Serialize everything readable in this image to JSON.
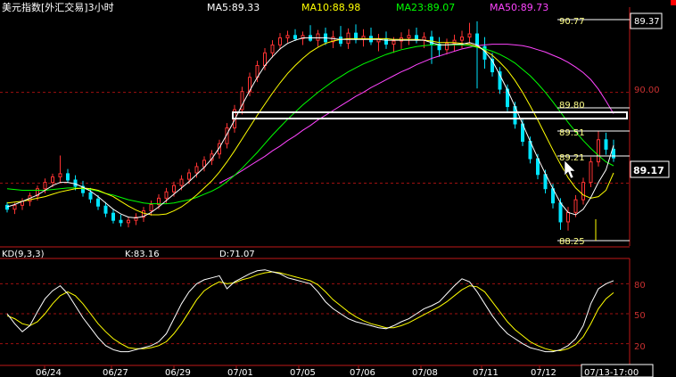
{
  "header": {
    "title": "美元指数[外汇交易]3小时",
    "ma_items": [
      {
        "label": "MA5:89.33",
        "color": "#ffffff"
      },
      {
        "label": "MA10:88.98",
        "color": "#ffff00"
      },
      {
        "label": "MA23:89.07",
        "color": "#00ff00"
      },
      {
        "label": "MA50:89.73",
        "color": "#ff44ff"
      }
    ]
  },
  "price_panel": {
    "price_scale": [
      "90.00",
      "89.37"
    ],
    "current_price": "89.17",
    "annotations": [
      "90.77",
      "89.80",
      "89.51",
      "89.21",
      "88.25"
    ]
  },
  "kd_panel": {
    "title": "KD(9,3,3)",
    "k_label": "K:83.16",
    "d_label": "D:71.07",
    "scale": [
      "80",
      "50",
      "20"
    ]
  },
  "date_axis": {
    "labels": [
      "06/24",
      "06/27",
      "06/29",
      "07/01",
      "07/05",
      "07/06",
      "07/08",
      "07/11",
      "07/12"
    ],
    "cursor_label": "07/13-17:00"
  },
  "colors": {
    "background": "#000000",
    "up_candle": "#ff3333",
    "down_candle": "#00e5ff",
    "grid_line": "#a01010",
    "ma5": "#ffffff",
    "ma10": "#ffff00",
    "ma23": "#00ff00",
    "ma50": "#ff44ff",
    "k_line": "#ffffff",
    "d_line": "#ffff00"
  },
  "chart_data": {
    "type": "candlestick",
    "unit": "DXY 3-hour",
    "ohlc": [
      [
        88.57,
        88.61,
        88.48,
        88.52
      ],
      [
        88.52,
        88.6,
        88.46,
        88.57
      ],
      [
        88.57,
        88.66,
        88.51,
        88.62
      ],
      [
        88.62,
        88.73,
        88.56,
        88.69
      ],
      [
        88.69,
        88.82,
        88.63,
        88.78
      ],
      [
        88.78,
        88.91,
        88.72,
        88.86
      ],
      [
        88.86,
        88.97,
        88.8,
        88.93
      ],
      [
        88.93,
        89.2,
        88.86,
        88.97
      ],
      [
        88.97,
        89.03,
        88.85,
        88.89
      ],
      [
        88.89,
        88.95,
        88.76,
        88.81
      ],
      [
        88.81,
        88.88,
        88.68,
        88.73
      ],
      [
        88.73,
        88.79,
        88.6,
        88.65
      ],
      [
        88.65,
        88.7,
        88.51,
        88.56
      ],
      [
        88.56,
        88.61,
        88.42,
        88.47
      ],
      [
        88.47,
        88.52,
        88.34,
        88.38
      ],
      [
        88.38,
        88.45,
        88.3,
        88.35
      ],
      [
        88.35,
        88.42,
        88.29,
        88.38
      ],
      [
        88.38,
        88.47,
        88.32,
        88.42
      ],
      [
        88.42,
        88.55,
        88.36,
        88.5
      ],
      [
        88.5,
        88.63,
        88.44,
        88.58
      ],
      [
        88.58,
        88.71,
        88.52,
        88.66
      ],
      [
        88.66,
        88.79,
        88.6,
        88.74
      ],
      [
        88.74,
        88.87,
        88.68,
        88.82
      ],
      [
        88.82,
        88.95,
        88.76,
        88.9
      ],
      [
        88.9,
        89.03,
        88.84,
        88.98
      ],
      [
        88.98,
        89.11,
        88.92,
        89.06
      ],
      [
        89.06,
        89.19,
        89.0,
        89.14
      ],
      [
        89.14,
        89.27,
        89.08,
        89.22
      ],
      [
        89.22,
        89.4,
        89.16,
        89.35
      ],
      [
        89.35,
        89.61,
        89.29,
        89.55
      ],
      [
        89.55,
        89.84,
        89.49,
        89.78
      ],
      [
        89.78,
        90.07,
        89.72,
        90.01
      ],
      [
        90.01,
        90.25,
        89.95,
        90.19
      ],
      [
        90.19,
        90.4,
        90.13,
        90.34
      ],
      [
        90.34,
        90.56,
        90.28,
        90.5
      ],
      [
        90.5,
        90.66,
        90.44,
        90.6
      ],
      [
        90.6,
        90.75,
        90.54,
        90.69
      ],
      [
        90.69,
        90.78,
        90.63,
        90.72
      ],
      [
        90.72,
        90.8,
        90.65,
        90.68
      ],
      [
        90.68,
        90.77,
        90.6,
        90.72
      ],
      [
        90.72,
        90.85,
        90.64,
        90.66
      ],
      [
        90.66,
        90.79,
        90.58,
        90.74
      ],
      [
        90.74,
        90.82,
        90.6,
        90.64
      ],
      [
        90.64,
        90.78,
        90.56,
        90.7
      ],
      [
        90.7,
        90.84,
        90.58,
        90.62
      ],
      [
        90.62,
        90.81,
        90.55,
        90.75
      ],
      [
        90.75,
        90.86,
        90.62,
        90.67
      ],
      [
        90.67,
        90.8,
        90.58,
        90.71
      ],
      [
        90.71,
        90.82,
        90.6,
        90.64
      ],
      [
        90.64,
        90.74,
        90.52,
        90.68
      ],
      [
        90.68,
        90.77,
        90.55,
        90.61
      ],
      [
        90.61,
        90.7,
        90.5,
        90.65
      ],
      [
        90.65,
        90.76,
        90.55,
        90.69
      ],
      [
        90.69,
        90.8,
        90.6,
        90.72
      ],
      [
        90.72,
        90.82,
        90.62,
        90.66
      ],
      [
        90.66,
        90.76,
        90.56,
        90.7
      ],
      [
        90.7,
        90.78,
        90.36,
        90.61
      ],
      [
        90.61,
        90.7,
        90.45,
        90.54
      ],
      [
        90.54,
        90.68,
        90.48,
        90.62
      ],
      [
        90.62,
        90.73,
        90.52,
        90.66
      ],
      [
        90.66,
        90.78,
        90.56,
        90.7
      ],
      [
        90.7,
        90.88,
        90.62,
        90.74
      ],
      [
        90.74,
        90.9,
        90.05,
        90.58
      ],
      [
        90.58,
        90.7,
        90.3,
        90.42
      ],
      [
        90.42,
        90.5,
        90.2,
        90.26
      ],
      [
        90.26,
        90.32,
        89.98,
        90.04
      ],
      [
        90.04,
        90.1,
        89.76,
        89.82
      ],
      [
        89.82,
        89.88,
        89.54,
        89.6
      ],
      [
        89.6,
        89.66,
        89.32,
        89.38
      ],
      [
        89.38,
        89.44,
        89.1,
        89.16
      ],
      [
        89.16,
        89.22,
        88.9,
        88.96
      ],
      [
        88.96,
        89.02,
        88.72,
        88.78
      ],
      [
        88.78,
        88.84,
        88.53,
        88.6
      ],
      [
        88.6,
        88.66,
        88.26,
        88.36
      ],
      [
        88.36,
        88.55,
        88.25,
        88.48
      ],
      [
        88.48,
        88.7,
        88.42,
        88.64
      ],
      [
        88.64,
        88.92,
        88.58,
        88.86
      ],
      [
        88.86,
        89.18,
        88.8,
        89.12
      ],
      [
        89.12,
        89.51,
        89.06,
        89.4
      ],
      [
        89.4,
        89.49,
        89.21,
        89.28
      ],
      [
        89.28,
        89.4,
        89.12,
        89.17
      ]
    ],
    "ma5": [
      88.55,
      88.58,
      88.62,
      88.66,
      88.7,
      88.76,
      88.82,
      88.86,
      88.86,
      88.84,
      88.8,
      88.75,
      88.68,
      88.6,
      88.52,
      88.46,
      88.42,
      88.41,
      88.43,
      88.48,
      88.55,
      88.63,
      88.71,
      88.79,
      88.87,
      88.96,
      89.05,
      89.16,
      89.3,
      89.47,
      89.65,
      89.84,
      90.02,
      90.19,
      90.34,
      90.45,
      90.55,
      90.62,
      90.66,
      90.69,
      90.69,
      90.69,
      90.69,
      90.68,
      90.67,
      90.67,
      90.67,
      90.67,
      90.67,
      90.67,
      90.66,
      90.66,
      90.66,
      90.66,
      90.66,
      90.66,
      90.63,
      90.6,
      90.6,
      90.61,
      90.61,
      90.63,
      90.6,
      90.52,
      90.4,
      90.22,
      90.03,
      89.82,
      89.6,
      89.38,
      89.17,
      88.97,
      88.78,
      88.6,
      88.48,
      88.45,
      88.52,
      88.67,
      88.86,
      89.02,
      89.33
    ],
    "ma10": [
      88.6,
      88.61,
      88.62,
      88.64,
      88.66,
      88.68,
      88.71,
      88.74,
      88.76,
      88.78,
      88.79,
      88.78,
      88.76,
      88.72,
      88.68,
      88.62,
      88.56,
      88.51,
      88.47,
      88.45,
      88.45,
      88.46,
      88.5,
      88.55,
      88.62,
      88.7,
      88.79,
      88.88,
      88.99,
      89.12,
      89.26,
      89.41,
      89.56,
      89.71,
      89.85,
      89.99,
      90.12,
      90.24,
      90.34,
      90.43,
      90.51,
      90.57,
      90.62,
      90.65,
      90.67,
      90.68,
      90.68,
      90.68,
      90.68,
      90.68,
      90.68,
      90.67,
      90.67,
      90.67,
      90.67,
      90.66,
      90.65,
      90.63,
      90.63,
      90.63,
      90.62,
      90.61,
      90.58,
      90.53,
      90.47,
      90.38,
      90.28,
      90.15,
      90.0,
      89.83,
      89.65,
      89.46,
      89.27,
      89.09,
      88.92,
      88.79,
      88.7,
      88.66,
      88.68,
      88.76,
      88.98
    ],
    "ma23": [
      88.78,
      88.77,
      88.76,
      88.76,
      88.76,
      88.76,
      88.77,
      88.78,
      88.79,
      88.79,
      88.78,
      88.77,
      88.75,
      88.72,
      88.7,
      88.67,
      88.64,
      88.62,
      88.6,
      88.59,
      88.59,
      88.59,
      88.6,
      88.62,
      88.64,
      88.67,
      88.71,
      88.75,
      88.8,
      88.87,
      88.95,
      89.04,
      89.14,
      89.24,
      89.35,
      89.46,
      89.56,
      89.66,
      89.75,
      89.84,
      89.92,
      90.0,
      90.07,
      90.14,
      90.2,
      90.26,
      90.31,
      90.36,
      90.4,
      90.44,
      90.48,
      90.51,
      90.54,
      90.56,
      90.58,
      90.59,
      90.6,
      90.6,
      90.6,
      90.6,
      90.6,
      90.59,
      90.57,
      90.55,
      90.52,
      90.48,
      90.43,
      90.37,
      90.29,
      90.21,
      90.11,
      90.0,
      89.88,
      89.75,
      89.62,
      89.5,
      89.39,
      89.29,
      89.2,
      89.12,
      89.07
    ],
    "ma50": [
      null,
      null,
      null,
      null,
      null,
      null,
      null,
      null,
      null,
      null,
      null,
      null,
      null,
      null,
      null,
      null,
      null,
      null,
      null,
      null,
      null,
      null,
      null,
      null,
      null,
      null,
      null,
      null,
      88.85,
      88.9,
      88.95,
      89.01,
      89.07,
      89.13,
      89.19,
      89.26,
      89.32,
      89.39,
      89.45,
      89.52,
      89.58,
      89.65,
      89.71,
      89.77,
      89.83,
      89.89,
      89.95,
      90.0,
      90.06,
      90.11,
      90.16,
      90.21,
      90.26,
      90.3,
      90.35,
      90.39,
      90.43,
      90.46,
      90.49,
      90.52,
      90.55,
      90.57,
      90.59,
      90.6,
      90.61,
      90.61,
      90.61,
      90.6,
      90.59,
      90.57,
      90.54,
      90.51,
      90.47,
      90.43,
      90.38,
      90.32,
      90.25,
      90.16,
      90.04,
      89.89,
      89.73
    ],
    "k": [
      50,
      40,
      32,
      38,
      52,
      65,
      73,
      78,
      70,
      58,
      46,
      36,
      26,
      18,
      14,
      12,
      12,
      14,
      16,
      18,
      22,
      30,
      45,
      60,
      72,
      80,
      84,
      86,
      88,
      75,
      82,
      86,
      90,
      93,
      94,
      92,
      90,
      86,
      84,
      82,
      80,
      72,
      62,
      55,
      50,
      45,
      42,
      40,
      38,
      36,
      35,
      38,
      42,
      45,
      50,
      55,
      58,
      62,
      70,
      78,
      85,
      82,
      72,
      60,
      48,
      38,
      30,
      25,
      20,
      16,
      14,
      12,
      12,
      14,
      18,
      25,
      38,
      60,
      75,
      80,
      83.16
    ],
    "d": [
      48,
      45,
      40,
      38,
      42,
      50,
      60,
      68,
      72,
      68,
      60,
      50,
      40,
      32,
      25,
      20,
      16,
      15,
      15,
      16,
      18,
      22,
      30,
      40,
      52,
      64,
      73,
      78,
      82,
      80,
      81,
      84,
      86,
      89,
      91,
      92,
      91,
      89,
      87,
      85,
      83,
      79,
      72,
      64,
      58,
      52,
      47,
      43,
      40,
      38,
      36,
      36,
      38,
      41,
      45,
      49,
      53,
      57,
      62,
      68,
      74,
      78,
      77,
      72,
      62,
      52,
      42,
      34,
      28,
      22,
      18,
      15,
      13,
      13,
      15,
      19,
      27,
      40,
      55,
      65,
      71.07
    ],
    "kd_scale": [
      20,
      50,
      80
    ],
    "dates": [
      "06/24",
      "06/27",
      "06/29",
      "07/01",
      "07/05",
      "07/06",
      "07/08",
      "07/11",
      "07/12"
    ],
    "ylim": [
      88.1,
      91.0
    ]
  }
}
